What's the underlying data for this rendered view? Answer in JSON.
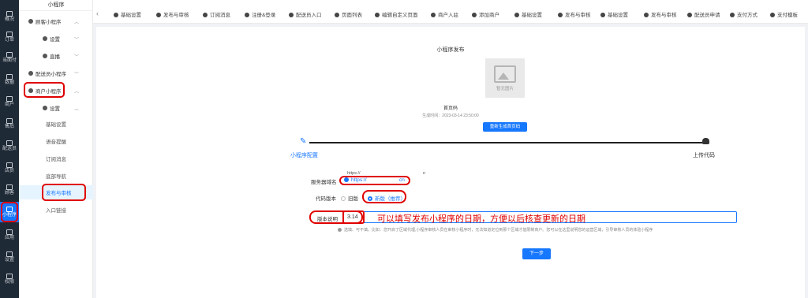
{
  "rail": {
    "items": [
      {
        "label": "概况",
        "icon": "overview-icon"
      },
      {
        "label": "订单",
        "icon": "order-icon"
      },
      {
        "label": "当面付",
        "icon": "facepay-icon"
      },
      {
        "label": "数据",
        "icon": "data-icon"
      },
      {
        "label": "商户",
        "icon": "merchant-icon"
      },
      {
        "label": "售后",
        "icon": "aftersale-icon"
      },
      {
        "label": "配送员",
        "icon": "courier-icon"
      },
      {
        "label": "店员",
        "icon": "clerk-icon"
      },
      {
        "label": "顾客",
        "icon": "customer-icon"
      },
      {
        "label": "小程序",
        "icon": "miniapp-icon"
      },
      {
        "label": "应用",
        "icon": "apps-icon"
      },
      {
        "label": "设置",
        "icon": "settings-icon"
      },
      {
        "label": "权限",
        "icon": "permission-icon"
      }
    ]
  },
  "menu": {
    "title": "小程序",
    "items": [
      {
        "label": "顾客小程序",
        "level": 0
      },
      {
        "label": "设置",
        "level": 1
      },
      {
        "label": "直播",
        "level": 1
      },
      {
        "label": "配送员小程序",
        "level": 0
      },
      {
        "label": "商户小程序",
        "level": 0
      },
      {
        "label": "设置",
        "level": 1
      },
      {
        "label": "基础设置",
        "level": 2
      },
      {
        "label": "语音提醒",
        "level": 2
      },
      {
        "label": "订阅消息",
        "level": 2
      },
      {
        "label": "底部导航",
        "level": 2
      },
      {
        "label": "发布与审核",
        "level": 2
      },
      {
        "label": "入口链接",
        "level": 2
      }
    ]
  },
  "tabs": [
    "基础设置",
    "发布与审核",
    "订阅消息",
    "注册&登录",
    "配送员入口",
    "页面列表",
    "编辑自定义页面",
    "商户入驻",
    "添加商户",
    "基础设置",
    "发布与审核",
    "基础设置",
    "发布与审核",
    "配送员申请",
    "支付方式",
    "支付模板"
  ],
  "publish": {
    "title": "小程序发布",
    "no_image": "暂无图片",
    "home_code": "首页码",
    "gen_time": "生成时间：2023-03-14 23:50:00",
    "regen_button": "重新生成首页码"
  },
  "steps": {
    "step1": "小程序配置",
    "step2": "上传代码"
  },
  "form": {
    "server_label": "服务器域名",
    "server_top": "https://",
    "server_top_tail": "n",
    "server_value": "https://",
    "server_tail": "cn",
    "version_type_label": "代码版本",
    "version_old": "旧版",
    "version_new": "新版（推荐）",
    "version_note_label": "版本说明",
    "version_note_value": "3.14",
    "annotation": "可以填写发布小程序的日期，方便以后核查更新的日期",
    "hint": "选填、可不填。比如：您开启了区域代理,小程序审核人员在审核小程序时，无法知道定位到那个区域才能限制商户。您可以在这里说明您的运营区域，引导审核人员的体验小程序",
    "next_button": "下一步"
  },
  "colors": {
    "accent": "#1677ff",
    "rail_bg": "#1f2a37",
    "highlight_red": "#e00000"
  }
}
